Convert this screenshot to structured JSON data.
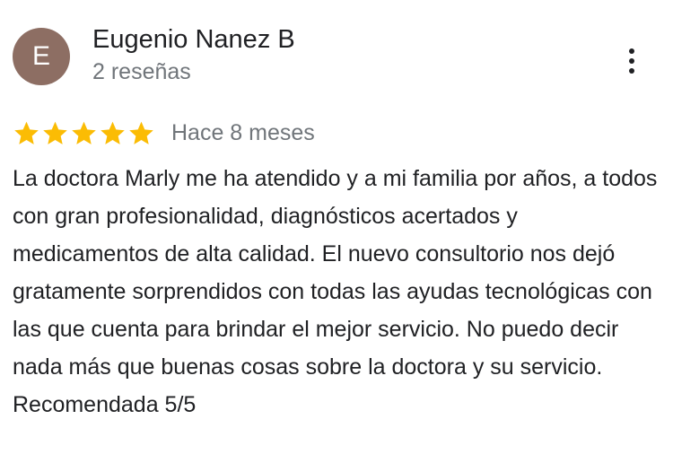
{
  "author": {
    "initial": "E",
    "name": "Eugenio Nanez B",
    "reviews_count": "2 reseñas",
    "avatar_color": "#8d6e63"
  },
  "menu": {
    "icon": "more-vert-icon"
  },
  "review": {
    "rating": 5,
    "rating_max": 5,
    "star_color": "#fbbc04",
    "date": "Hace 8 meses",
    "text": "La doctora Marly me ha atendido y a mi familia por años, a todos con gran profesionalidad, diagnósticos acertados y medicamentos de alta calidad. El nuevo consultorio nos dejó gratamente sorprendidos con todas las ayudas tecnológicas con las que cuenta para brindar el mejor servicio. No puedo decir nada más que buenas cosas sobre la doctora y su servicio. Recomendada 5/5"
  }
}
